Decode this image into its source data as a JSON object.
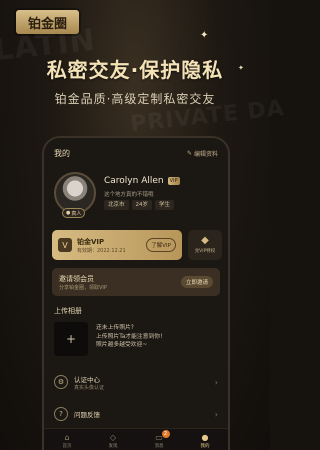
{
  "brand": "铂金圈",
  "watermarks": [
    "LATIN",
    "PRIVATE DA"
  ],
  "headline": "私密交友·保护隐私",
  "subline": "铂金品质·高级定制私密交友",
  "screen": {
    "title": "我的",
    "edit_label": "编辑资料",
    "profile": {
      "name": "Carolyn Allen",
      "vip_tag": "VIP",
      "bio": "这个地方真的不错哦",
      "tags": [
        "北京市",
        "24岁",
        "学生"
      ],
      "real_badge": "真人"
    },
    "vip_card": {
      "title": "铂金VIP",
      "expiry": "有效期：2022.12.21",
      "button": "了解VIP"
    },
    "privilege_label": "兑VIP特权",
    "invite": {
      "title": "邀请领会员",
      "subtitle": "分享铂金圈，领取VIP",
      "button": "立即邀请"
    },
    "album": {
      "title": "上传相册",
      "add_symbol": "+",
      "lines": [
        "还未上传照片?",
        "上传照片Ta才能注意到你!",
        "照片越多越受欢迎~"
      ]
    },
    "menu": [
      {
        "label": "认证中心",
        "sub": "真实头像认证"
      },
      {
        "label": "问题反馈",
        "sub": ""
      }
    ],
    "tabs": [
      {
        "label": "首页",
        "icon": "home-icon"
      },
      {
        "label": "发现",
        "icon": "discover-icon"
      },
      {
        "label": "消息",
        "icon": "message-icon",
        "badge": "2"
      },
      {
        "label": "我的",
        "icon": "profile-icon"
      }
    ]
  },
  "colors": {
    "gold": "#d6bb82",
    "background": "#16130f",
    "badge": "#e07a2b"
  }
}
